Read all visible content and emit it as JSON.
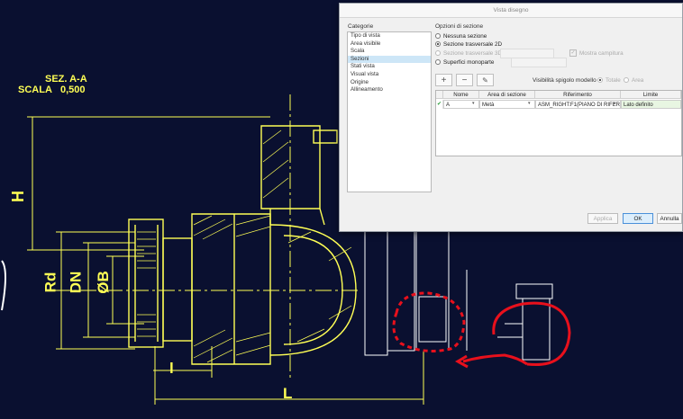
{
  "drawing": {
    "section_title": "SEZ. A-A",
    "scale_label": "SCALA",
    "scale_value": "0,500",
    "dimensions": {
      "H": "H",
      "Rd": "Rd",
      "DN": "DN",
      "B": "B",
      "B_prefix": "Ø",
      "l": "l",
      "L": "L"
    },
    "colors": {
      "background": "#0a1030",
      "lines": "#ffff55",
      "geometry": "#ffffff",
      "hatch": "#ffff55",
      "annotation": "#e8101c"
    }
  },
  "dialog": {
    "title": "Vista disegno",
    "categories_label": "Categorie",
    "categories": [
      "Tipo di vista",
      "Area visibile",
      "Scala",
      "Sezioni",
      "Stati vista",
      "Visual vista",
      "Origine",
      "Allineamento"
    ],
    "selected_category": "Sezioni",
    "section_options_label": "Opzioni di sezione",
    "options": {
      "none": "Nessuna sezione",
      "section_2d": "Sezione trasversale 2D",
      "section_3d": "Sezione trasversale 3D",
      "single_surface": "Superfici monoparte",
      "show_hatch": "Mostra campitura"
    },
    "edge_visibility_label": "Visibilità spigolo modello",
    "edge_total": "Totale",
    "edge_area": "Area",
    "toolbar": {
      "add": "+",
      "remove": "−",
      "edit": "✎"
    },
    "table": {
      "columns": [
        "",
        "Nome",
        "Area di sezione",
        "Riferimento",
        "Limite"
      ],
      "rows": [
        {
          "check": "✔",
          "name": "A",
          "area": "Metà",
          "reference": "ASM_RIGHT:F1(PIANO DI RIFERI",
          "limit": "Lato definito"
        }
      ]
    },
    "buttons": {
      "apply": "Applica",
      "ok": "OK",
      "cancel": "Annulla"
    }
  }
}
